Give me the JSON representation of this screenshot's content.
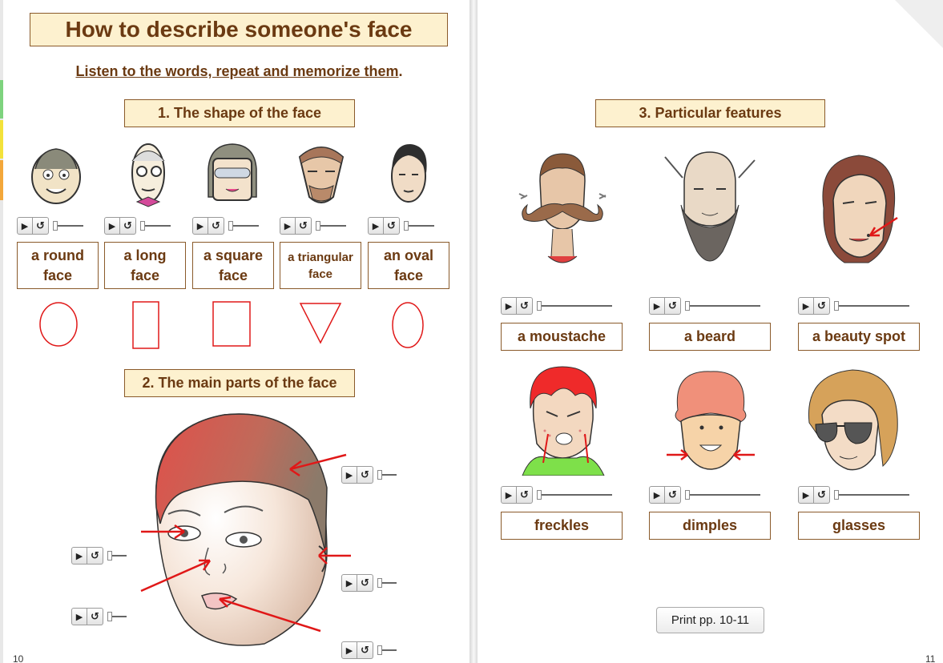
{
  "title": "How to describe someone's face",
  "instruction": "Listen to the words, repeat and memorize them",
  "instruction_end": ".",
  "sections": {
    "shape": "1. The shape of the face",
    "parts": "2. The main parts of the face",
    "features": "3. Particular features"
  },
  "face_shapes": [
    {
      "line1": "a round",
      "line2": "face"
    },
    {
      "line1": "a long",
      "line2": "face"
    },
    {
      "line1": "a square",
      "line2": "face"
    },
    {
      "line1": "a triangular",
      "line2": "face"
    },
    {
      "line1": "an oval",
      "line2": "face"
    }
  ],
  "features": [
    "a moustache",
    "a beard",
    "a beauty spot",
    "freckles",
    "dimples",
    "glasses"
  ],
  "player": {
    "play_icon": "play-icon",
    "replay_icon": "replay-icon",
    "play_glyph": "▶",
    "replay_glyph": "↺"
  },
  "print_button": "Print pp. 10-11",
  "page_numbers": {
    "left": "10",
    "right": "11"
  },
  "colors": {
    "accent": "#fdf1cf",
    "border": "#8a5a2a",
    "text": "#6b3a12",
    "shape_red": "#e01818"
  }
}
